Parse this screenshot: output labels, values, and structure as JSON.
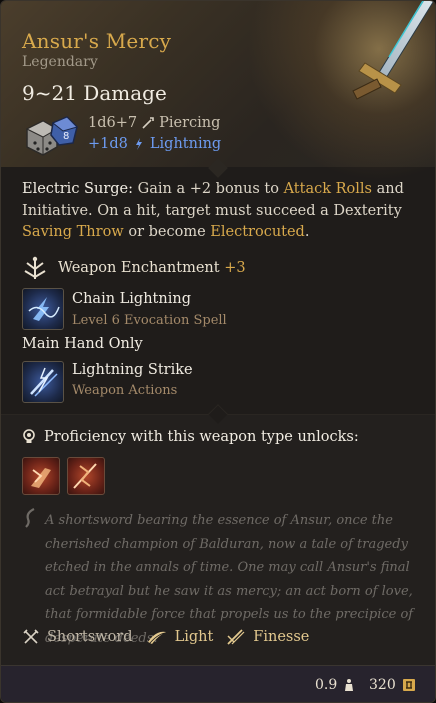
{
  "item": {
    "name": "Ansur's Mercy",
    "rarity": "Legendary",
    "damage": "9~21 Damage",
    "damage_lines": [
      {
        "dice": "1d6+7",
        "type": "Piercing"
      },
      {
        "dice": "+1d8",
        "type": "Lightning"
      }
    ]
  },
  "description": {
    "label": "Electric Surge:",
    "part1": " Gain a +2 bonus to ",
    "attack_rolls": "Attack Rolls",
    "part2": " and Initiative. On a hit, target must succeed a Dexterity ",
    "saving_throw": "Saving Throw",
    "part3": " or become ",
    "electrocuted": "Electrocuted",
    "part4": "."
  },
  "enchantment": {
    "label": "Weapon Enchantment",
    "value": "+3"
  },
  "spells": [
    {
      "name": "Chain Lightning",
      "subtitle": "Level 6 Evocation Spell",
      "icon": "chain-lightning-icon"
    },
    {
      "name": "Lightning Strike",
      "subtitle": "Weapon Actions",
      "icon": "lightning-strike-icon"
    }
  ],
  "main_hand_only": "Main Hand Only",
  "proficiency": {
    "label": "Proficiency with this weapon type unlocks:",
    "actions": [
      {
        "icon": "weapon-action-1-icon"
      },
      {
        "icon": "weapon-action-2-icon"
      }
    ]
  },
  "lore": "A shortsword bearing the essence of Ansur, once the cherished champion of Balduran, now a tale of tragedy etched in the annals of time. One may call Ansur's final act betrayal but he saw it as mercy; an act born of love, that formidable force that propels us to the precipice of desperate deeds.",
  "properties": [
    {
      "label": "Shortsword",
      "icon": "shortsword-icon",
      "style": "base"
    },
    {
      "label": "Light",
      "icon": "light-icon",
      "style": "gold"
    },
    {
      "label": "Finesse",
      "icon": "finesse-icon",
      "style": "gold"
    }
  ],
  "footer": {
    "weight": "0.9",
    "value": "320"
  },
  "colors": {
    "title_gold": "#d8a94c",
    "lightning_blue": "#6d9bf0",
    "lore_gray": "#6f6b66"
  }
}
